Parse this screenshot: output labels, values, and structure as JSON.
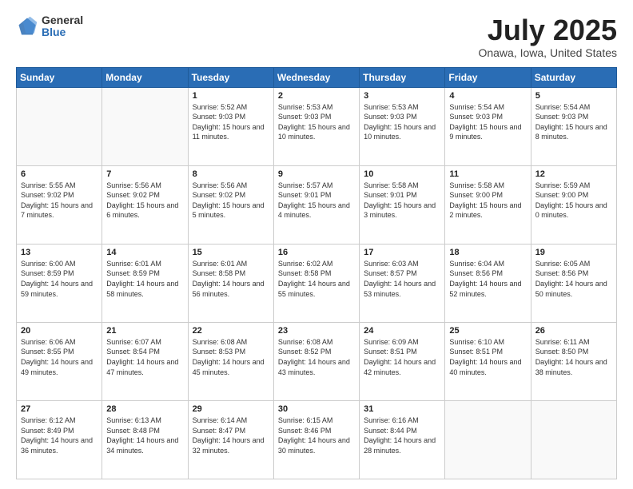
{
  "header": {
    "logo_general": "General",
    "logo_blue": "Blue",
    "main_title": "July 2025",
    "subtitle": "Onawa, Iowa, United States"
  },
  "calendar": {
    "days_of_week": [
      "Sunday",
      "Monday",
      "Tuesday",
      "Wednesday",
      "Thursday",
      "Friday",
      "Saturday"
    ],
    "weeks": [
      [
        {
          "day": "",
          "sunrise": "",
          "sunset": "",
          "daylight": "",
          "empty": true
        },
        {
          "day": "",
          "sunrise": "",
          "sunset": "",
          "daylight": "",
          "empty": true
        },
        {
          "day": "1",
          "sunrise": "Sunrise: 5:52 AM",
          "sunset": "Sunset: 9:03 PM",
          "daylight": "Daylight: 15 hours and 11 minutes."
        },
        {
          "day": "2",
          "sunrise": "Sunrise: 5:53 AM",
          "sunset": "Sunset: 9:03 PM",
          "daylight": "Daylight: 15 hours and 10 minutes."
        },
        {
          "day": "3",
          "sunrise": "Sunrise: 5:53 AM",
          "sunset": "Sunset: 9:03 PM",
          "daylight": "Daylight: 15 hours and 10 minutes."
        },
        {
          "day": "4",
          "sunrise": "Sunrise: 5:54 AM",
          "sunset": "Sunset: 9:03 PM",
          "daylight": "Daylight: 15 hours and 9 minutes."
        },
        {
          "day": "5",
          "sunrise": "Sunrise: 5:54 AM",
          "sunset": "Sunset: 9:03 PM",
          "daylight": "Daylight: 15 hours and 8 minutes."
        }
      ],
      [
        {
          "day": "6",
          "sunrise": "Sunrise: 5:55 AM",
          "sunset": "Sunset: 9:02 PM",
          "daylight": "Daylight: 15 hours and 7 minutes."
        },
        {
          "day": "7",
          "sunrise": "Sunrise: 5:56 AM",
          "sunset": "Sunset: 9:02 PM",
          "daylight": "Daylight: 15 hours and 6 minutes."
        },
        {
          "day": "8",
          "sunrise": "Sunrise: 5:56 AM",
          "sunset": "Sunset: 9:02 PM",
          "daylight": "Daylight: 15 hours and 5 minutes."
        },
        {
          "day": "9",
          "sunrise": "Sunrise: 5:57 AM",
          "sunset": "Sunset: 9:01 PM",
          "daylight": "Daylight: 15 hours and 4 minutes."
        },
        {
          "day": "10",
          "sunrise": "Sunrise: 5:58 AM",
          "sunset": "Sunset: 9:01 PM",
          "daylight": "Daylight: 15 hours and 3 minutes."
        },
        {
          "day": "11",
          "sunrise": "Sunrise: 5:58 AM",
          "sunset": "Sunset: 9:00 PM",
          "daylight": "Daylight: 15 hours and 2 minutes."
        },
        {
          "day": "12",
          "sunrise": "Sunrise: 5:59 AM",
          "sunset": "Sunset: 9:00 PM",
          "daylight": "Daylight: 15 hours and 0 minutes."
        }
      ],
      [
        {
          "day": "13",
          "sunrise": "Sunrise: 6:00 AM",
          "sunset": "Sunset: 8:59 PM",
          "daylight": "Daylight: 14 hours and 59 minutes."
        },
        {
          "day": "14",
          "sunrise": "Sunrise: 6:01 AM",
          "sunset": "Sunset: 8:59 PM",
          "daylight": "Daylight: 14 hours and 58 minutes."
        },
        {
          "day": "15",
          "sunrise": "Sunrise: 6:01 AM",
          "sunset": "Sunset: 8:58 PM",
          "daylight": "Daylight: 14 hours and 56 minutes."
        },
        {
          "day": "16",
          "sunrise": "Sunrise: 6:02 AM",
          "sunset": "Sunset: 8:58 PM",
          "daylight": "Daylight: 14 hours and 55 minutes."
        },
        {
          "day": "17",
          "sunrise": "Sunrise: 6:03 AM",
          "sunset": "Sunset: 8:57 PM",
          "daylight": "Daylight: 14 hours and 53 minutes."
        },
        {
          "day": "18",
          "sunrise": "Sunrise: 6:04 AM",
          "sunset": "Sunset: 8:56 PM",
          "daylight": "Daylight: 14 hours and 52 minutes."
        },
        {
          "day": "19",
          "sunrise": "Sunrise: 6:05 AM",
          "sunset": "Sunset: 8:56 PM",
          "daylight": "Daylight: 14 hours and 50 minutes."
        }
      ],
      [
        {
          "day": "20",
          "sunrise": "Sunrise: 6:06 AM",
          "sunset": "Sunset: 8:55 PM",
          "daylight": "Daylight: 14 hours and 49 minutes."
        },
        {
          "day": "21",
          "sunrise": "Sunrise: 6:07 AM",
          "sunset": "Sunset: 8:54 PM",
          "daylight": "Daylight: 14 hours and 47 minutes."
        },
        {
          "day": "22",
          "sunrise": "Sunrise: 6:08 AM",
          "sunset": "Sunset: 8:53 PM",
          "daylight": "Daylight: 14 hours and 45 minutes."
        },
        {
          "day": "23",
          "sunrise": "Sunrise: 6:08 AM",
          "sunset": "Sunset: 8:52 PM",
          "daylight": "Daylight: 14 hours and 43 minutes."
        },
        {
          "day": "24",
          "sunrise": "Sunrise: 6:09 AM",
          "sunset": "Sunset: 8:51 PM",
          "daylight": "Daylight: 14 hours and 42 minutes."
        },
        {
          "day": "25",
          "sunrise": "Sunrise: 6:10 AM",
          "sunset": "Sunset: 8:51 PM",
          "daylight": "Daylight: 14 hours and 40 minutes."
        },
        {
          "day": "26",
          "sunrise": "Sunrise: 6:11 AM",
          "sunset": "Sunset: 8:50 PM",
          "daylight": "Daylight: 14 hours and 38 minutes."
        }
      ],
      [
        {
          "day": "27",
          "sunrise": "Sunrise: 6:12 AM",
          "sunset": "Sunset: 8:49 PM",
          "daylight": "Daylight: 14 hours and 36 minutes."
        },
        {
          "day": "28",
          "sunrise": "Sunrise: 6:13 AM",
          "sunset": "Sunset: 8:48 PM",
          "daylight": "Daylight: 14 hours and 34 minutes."
        },
        {
          "day": "29",
          "sunrise": "Sunrise: 6:14 AM",
          "sunset": "Sunset: 8:47 PM",
          "daylight": "Daylight: 14 hours and 32 minutes."
        },
        {
          "day": "30",
          "sunrise": "Sunrise: 6:15 AM",
          "sunset": "Sunset: 8:46 PM",
          "daylight": "Daylight: 14 hours and 30 minutes."
        },
        {
          "day": "31",
          "sunrise": "Sunrise: 6:16 AM",
          "sunset": "Sunset: 8:44 PM",
          "daylight": "Daylight: 14 hours and 28 minutes."
        },
        {
          "day": "",
          "sunrise": "",
          "sunset": "",
          "daylight": "",
          "empty": true
        },
        {
          "day": "",
          "sunrise": "",
          "sunset": "",
          "daylight": "",
          "empty": true
        }
      ]
    ]
  }
}
